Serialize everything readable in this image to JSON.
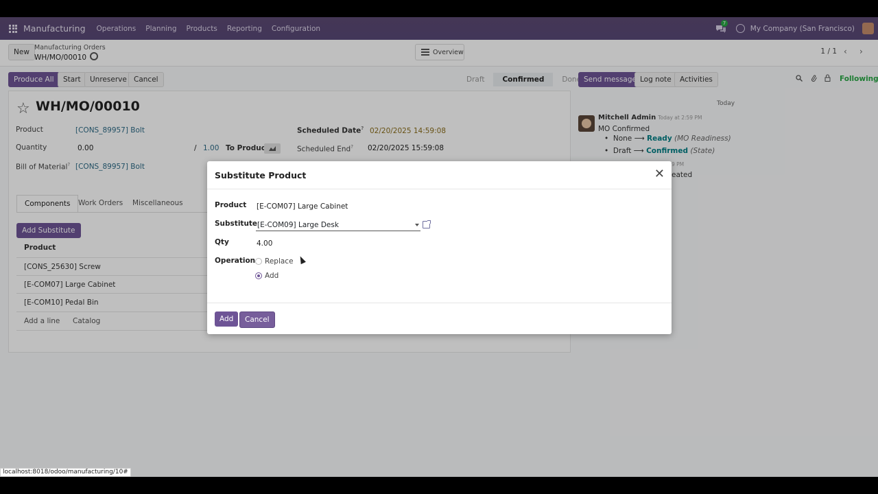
{
  "navbar": {
    "app_name": "Manufacturing",
    "menus": [
      "Operations",
      "Planning",
      "Products",
      "Reporting",
      "Configuration"
    ],
    "chat_badge": "7",
    "company": "My Company (San Francisco)"
  },
  "control": {
    "new_label": "New",
    "breadcrumb_parent": "Manufacturing Orders",
    "breadcrumb_current": "WH/MO/00010",
    "overview_label": "Overview",
    "pager": "1 / 1"
  },
  "actions": {
    "produce_all": "Produce All",
    "start": "Start",
    "unreserve": "Unreserve",
    "cancel": "Cancel"
  },
  "status_steps": [
    "Draft",
    "Confirmed",
    "Done"
  ],
  "form": {
    "title": "WH/MO/00010",
    "product_label": "Product",
    "product_value": "[CONS_89957] Bolt",
    "quantity_label": "Quantity",
    "quantity_value": "0.00",
    "quantity_slash": "/",
    "quantity_total": "1.00",
    "to_produce": "To Produce",
    "bom_label": "Bill of Material",
    "bom_value": "[CONS_89957] Bolt",
    "scheduled_date_label": "Scheduled Date",
    "scheduled_date_value": "02/20/2025 14:59:08",
    "scheduled_end_label": "Scheduled End",
    "scheduled_end_value": "02/20/2025 15:59:08",
    "help_mark": "?",
    "tabs": [
      "Components",
      "Work Orders",
      "Miscellaneous"
    ],
    "add_substitute": "Add Substitute",
    "column_product": "Product",
    "rows": [
      "[CONS_25630] Screw",
      "[E-COM07] Large Cabinet",
      "[E-COM10] Pedal Bin"
    ],
    "add_line": "Add a line",
    "catalog": "Catalog"
  },
  "chatter": {
    "send_message": "Send message",
    "log_note": "Log note",
    "activities": "Activities",
    "following": "Following",
    "today": "Today",
    "author": "Mitchell Admin",
    "time": "Today at 2:59 PM",
    "message": "MO Confirmed",
    "change1_from": "None",
    "change1_to": "Ready",
    "change1_field": "(MO Readiness)",
    "change2_from": "Draft",
    "change2_to": "Confirmed",
    "change2_field": "(State)",
    "partial_time": "9 PM",
    "partial_text": "eated"
  },
  "modal": {
    "title": "Substitute Product",
    "product_label": "Product",
    "product_value": "[E-COM07] Large Cabinet",
    "substitute_label": "Substitute",
    "substitute_value": "[E-COM09] Large Desk",
    "qty_label": "Qty",
    "qty_value": "4.00",
    "operation_label": "Operation",
    "options": [
      "Replace",
      "Add"
    ],
    "selected_option": "Add",
    "add_button": "Add",
    "cancel_button": "Cancel"
  },
  "status_url": "localhost:8018/odoo/manufacturing/10#",
  "colors": {
    "navbar": "#594877",
    "primary": "#6e5496",
    "link_teal": "#017e84"
  }
}
